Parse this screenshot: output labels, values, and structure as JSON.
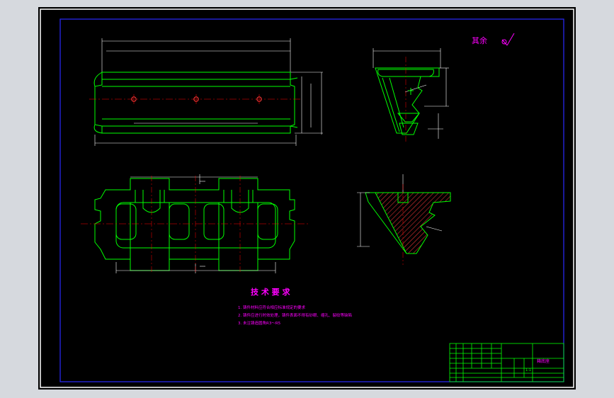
{
  "drawing": {
    "roughness_note": "其余",
    "tech_req": {
      "title": "技 术 要 求",
      "items": [
        "1. 铸件材料应符合相应标准规定的要求",
        "2. 铸件应进行时效处理，铸件表面不得有砂眼、缩孔、裂纹等缺陷",
        "3. 未注铸造圆角R3～R5"
      ]
    },
    "title_block": {
      "part_name": "箱底座",
      "scale": "1:1"
    }
  },
  "colors": {
    "background": "#000000",
    "outline": "#00ff00",
    "dimension": "#ffffff",
    "centerline": "#ff0000",
    "annotation": "#ff00ff",
    "hatch": "#ff3b3b",
    "sheet_frame": "#2a2aff"
  }
}
